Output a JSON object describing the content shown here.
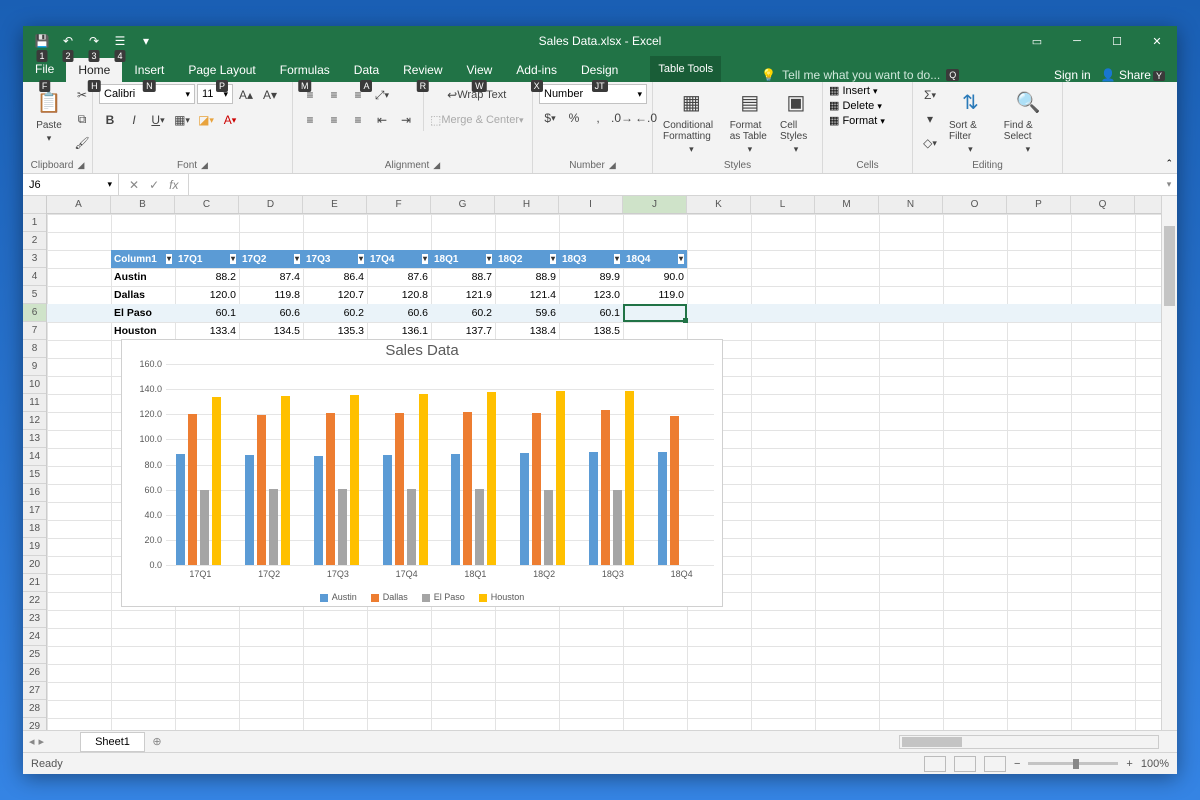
{
  "app": {
    "title": "Sales Data.xlsx - Excel",
    "table_tools": "Table Tools",
    "signin": "Sign in",
    "share": "Share",
    "tellme": "Tell me what you want to do..."
  },
  "qat_keytips": [
    "1",
    "2",
    "3",
    "4"
  ],
  "tabs": [
    {
      "label": "File",
      "kt": "F"
    },
    {
      "label": "Home",
      "kt": "H",
      "active": true
    },
    {
      "label": "Insert",
      "kt": "N"
    },
    {
      "label": "Page Layout",
      "kt": "P"
    },
    {
      "label": "Formulas",
      "kt": "M"
    },
    {
      "label": "Data",
      "kt": "A"
    },
    {
      "label": "Review",
      "kt": "R"
    },
    {
      "label": "View",
      "kt": "W"
    },
    {
      "label": "Add-ins",
      "kt": "X"
    },
    {
      "label": "Design",
      "kt": "JT"
    }
  ],
  "ribbon": {
    "clipboard": "Clipboard",
    "paste": "Paste",
    "font": "Font",
    "font_name": "Calibri",
    "font_size": "11",
    "alignment": "Alignment",
    "wrap": "Wrap Text",
    "merge": "Merge & Center",
    "number": "Number",
    "number_format": "Number",
    "styles": "Styles",
    "cf": "Conditional Formatting",
    "fat": "Format as Table",
    "cs": "Cell Styles",
    "cells": "Cells",
    "insert": "Insert",
    "delete": "Delete",
    "format": "Format",
    "editing": "Editing",
    "sortfilter": "Sort & Filter",
    "findselect": "Find & Select"
  },
  "namebox": "J6",
  "columns": [
    "A",
    "B",
    "C",
    "D",
    "E",
    "F",
    "G",
    "H",
    "I",
    "J",
    "K",
    "L",
    "M",
    "N",
    "O",
    "P",
    "Q"
  ],
  "row_count": 30,
  "table": {
    "start_col": 1,
    "header_row": 2,
    "headers": [
      "Column1",
      "17Q1",
      "17Q2",
      "17Q3",
      "17Q4",
      "18Q1",
      "18Q2",
      "18Q3",
      "18Q4"
    ],
    "rows": [
      {
        "city": "Austin",
        "vals": [
          88.2,
          87.4,
          86.4,
          87.6,
          88.7,
          88.9,
          89.9,
          90.0
        ]
      },
      {
        "city": "Dallas",
        "vals": [
          120.0,
          119.8,
          120.7,
          120.8,
          121.9,
          121.4,
          123.0,
          119.0
        ]
      },
      {
        "city": "El Paso",
        "vals": [
          60.1,
          60.6,
          60.2,
          60.6,
          60.2,
          59.6,
          60.1,
          null
        ]
      },
      {
        "city": "Houston",
        "vals": [
          133.4,
          134.5,
          135.3,
          136.1,
          137.7,
          138.4,
          138.5,
          null
        ]
      }
    ]
  },
  "cursor": {
    "col": 9,
    "row": 5
  },
  "chart_data": {
    "type": "bar",
    "title": "Sales Data",
    "categories": [
      "17Q1",
      "17Q2",
      "17Q3",
      "17Q4",
      "18Q1",
      "18Q2",
      "18Q3",
      "18Q4"
    ],
    "series": [
      {
        "name": "Austin",
        "color": "#5B9BD5",
        "values": [
          88.2,
          87.4,
          86.4,
          87.6,
          88.7,
          88.9,
          89.9,
          90.0
        ]
      },
      {
        "name": "Dallas",
        "color": "#ED7D31",
        "values": [
          120.0,
          119.8,
          120.7,
          120.8,
          121.9,
          121.4,
          123.0,
          119.0
        ]
      },
      {
        "name": "El Paso",
        "color": "#A5A5A5",
        "values": [
          60.1,
          60.6,
          60.2,
          60.6,
          60.2,
          59.6,
          60.1,
          null
        ]
      },
      {
        "name": "Houston",
        "color": "#FFC000",
        "values": [
          133.4,
          134.5,
          135.3,
          136.1,
          137.7,
          138.4,
          138.5,
          null
        ]
      }
    ],
    "ylim": [
      0,
      160
    ],
    "yticks": [
      0,
      20,
      40,
      60,
      80,
      100,
      120,
      140,
      160
    ]
  },
  "sheet_tab": "Sheet1",
  "status": "Ready",
  "zoom": "100%"
}
